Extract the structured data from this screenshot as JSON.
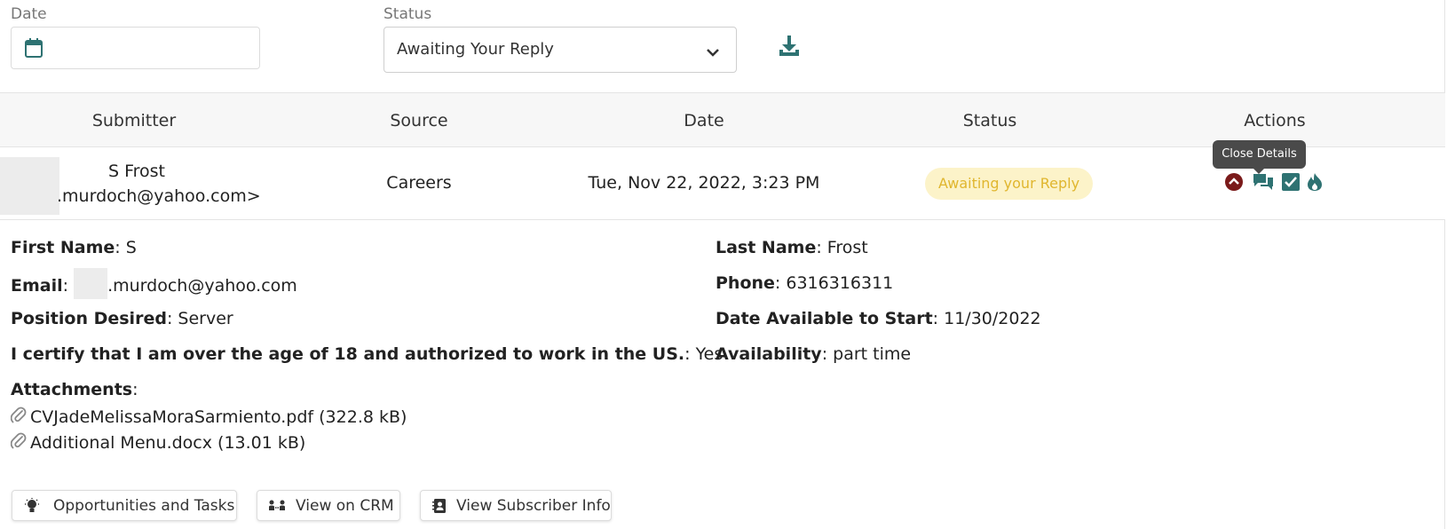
{
  "filters": {
    "date_label": "Date",
    "status_label": "Status",
    "status_value": "Awaiting Your Reply"
  },
  "table": {
    "headers": [
      "Submitter",
      "Source",
      "Date",
      "Status",
      "Actions"
    ],
    "row": {
      "submitter_name": "S Frost",
      "submitter_email": ".murdoch@yahoo.com>",
      "source": "Careers",
      "date": "Tue, Nov 22, 2022, 3:23 PM",
      "status": "Awaiting your Reply",
      "tooltip": "Close Details"
    }
  },
  "details": {
    "first_name_label": "First Name",
    "first_name": "S",
    "last_name_label": "Last Name",
    "last_name": "Frost",
    "email_label": "Email",
    "email": ".murdoch@yahoo.com",
    "phone_label": "Phone",
    "phone": "6316316311",
    "position_label": "Position Desired",
    "position": "Server",
    "date_available_label": "Date Available to Start",
    "date_available": "11/30/2022",
    "certify_label": "I certify that I am over the age of 18 and authorized to work in the US.",
    "certify": "Yes",
    "availability_label": "Availability",
    "availability": "part time",
    "attachments_label": "Attachments",
    "attachments": [
      "CVJadeMelissaMoraSarmiento.pdf (322.8 kB)",
      "Additional Menu.docx (13.01 kB)"
    ]
  },
  "buttons": {
    "opportunities": "Opportunities and Tasks",
    "crm": "View on CRM",
    "subscriber": "View Subscriber Info"
  },
  "colors": {
    "teal": "#2e7272",
    "badge_bg": "#fcf3c9",
    "badge_text": "#e0b62e",
    "close_icon": "#7a1a1a"
  },
  "icons": [
    "calendar-icon",
    "chevron-down-icon",
    "download-icon",
    "chevron-up-circle-icon",
    "chat-icon",
    "checkbox-icon",
    "fire-icon",
    "paperclip-icon",
    "lightbulb-icon",
    "people-icon",
    "contact-card-icon"
  ]
}
